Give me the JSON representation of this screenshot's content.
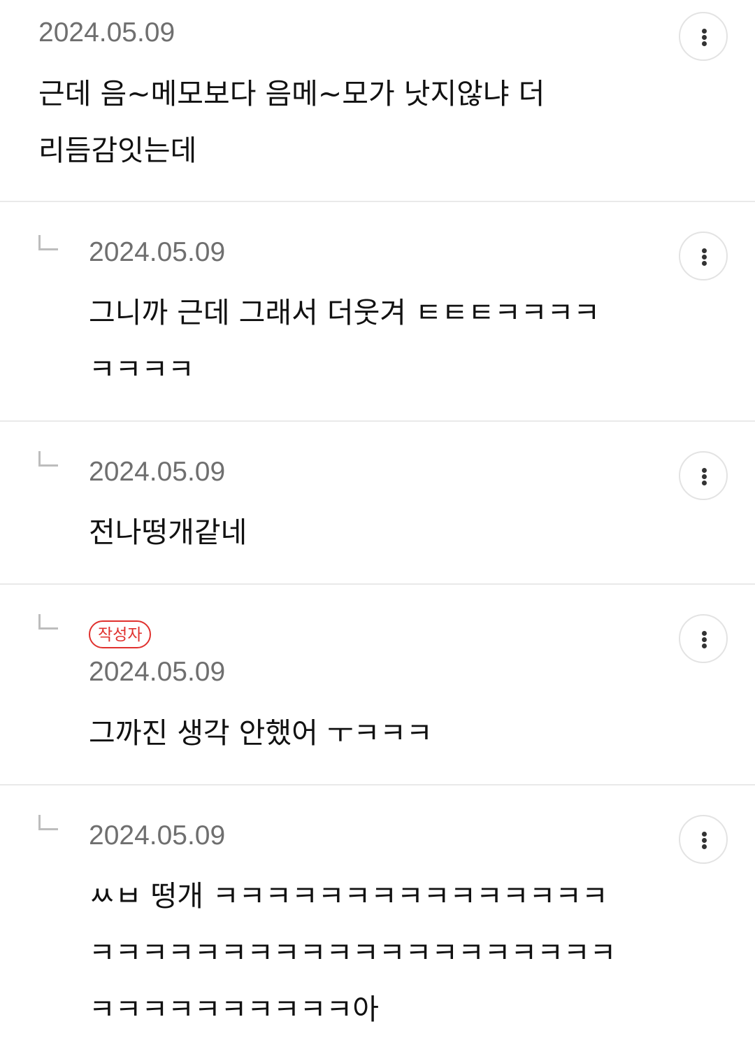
{
  "comments": [
    {
      "date": "2024.05.09",
      "text": "근데 음~메모보다 음메~모가 낫지않냐 더\n리듬감잇는데",
      "more_icon": "more-vertical-icon"
    },
    {
      "date": "2024.05.09",
      "text": "그니까 근데 그래서 더웃겨 ㅌㅌㅌㅋㅋㅋㅋ\nㅋㅋㅋㅋ",
      "more_icon": "more-vertical-icon"
    },
    {
      "date": "2024.05.09",
      "text": "전나떵개같네",
      "more_icon": "more-vertical-icon"
    },
    {
      "badge": "작성자",
      "date": "2024.05.09",
      "text": "그까진 생각 안했어 ㅜㅋㅋㅋ",
      "more_icon": "more-vertical-icon"
    },
    {
      "date": "2024.05.09",
      "text": "ㅆㅂ 떵개 ㅋㅋㅋㅋㅋㅋㅋㅋㅋㅋㅋㅋㅋㅋㅋ\nㅋㅋㅋㅋㅋㅋㅋㅋㅋㅋㅋㅋㅋㅋㅋㅋㅋㅋㅋㅋ\nㅋㅋㅋㅋㅋㅋㅋㅋㅋㅋ아",
      "more_icon": "more-vertical-icon"
    }
  ],
  "colors": {
    "author_badge": "#e0312e",
    "date_text": "#6f6f6f",
    "divider": "#e9e9e9"
  }
}
